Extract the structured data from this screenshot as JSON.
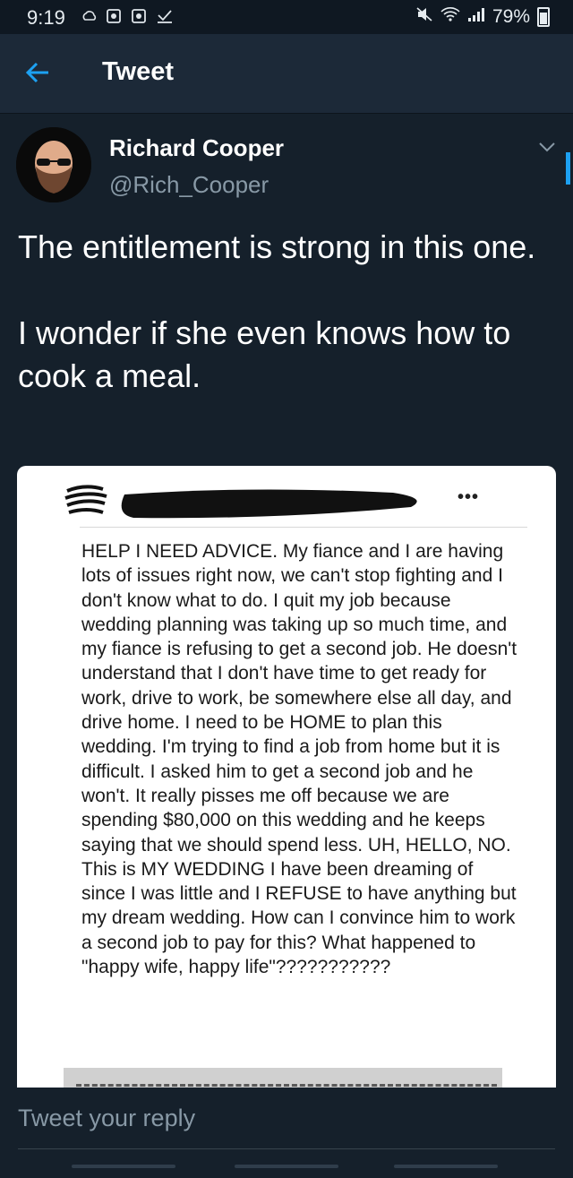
{
  "status_bar": {
    "time": "9:19",
    "battery": "79%",
    "left_icons": [
      "cloud-icon",
      "notification-icon",
      "notification-icon",
      "download-check-icon"
    ],
    "right_icons": [
      "mute-icon",
      "wifi-icon",
      "signal-icon",
      "battery-icon"
    ]
  },
  "header": {
    "title": "Tweet",
    "back_icon": "arrow-left-icon"
  },
  "tweet": {
    "author_name": "Richard Cooper",
    "author_handle": "@Rich_Cooper",
    "paragraphs": [
      "The entitlement is strong in this one.",
      "I wonder if she even knows how to cook a meal."
    ]
  },
  "embed": {
    "more_label": "•••",
    "post_text": "HELP I NEED ADVICE. My fiance and I are having lots of issues right now, we can't stop fighting and I don't know what to do. I quit my job because wedding planning was taking up so much time, and my fiance is refusing to get a second job. He doesn't understand that I don't have time to get ready for work, drive to work, be somewhere else all day, and drive home. I need to be HOME to plan this wedding. I'm trying to find a job from home but it is difficult. I asked him to get a second job and he won't. It really pisses me off because we are spending $80,000 on this wedding and he keeps saying that we should spend less. UH, HELLO, NO. This is MY WEDDING I have been dreaming of since I was little and I REFUSE to have anything but my dream wedding. How can I convince him to work a second job to pay for this? What happened to \"happy wife, happy life\"???????????"
  },
  "reply": {
    "placeholder": "Tweet your reply"
  },
  "colors": {
    "background": "#15202b",
    "header": "#1c2938",
    "accent": "#1da1f2",
    "secondary_text": "#8899a6"
  }
}
